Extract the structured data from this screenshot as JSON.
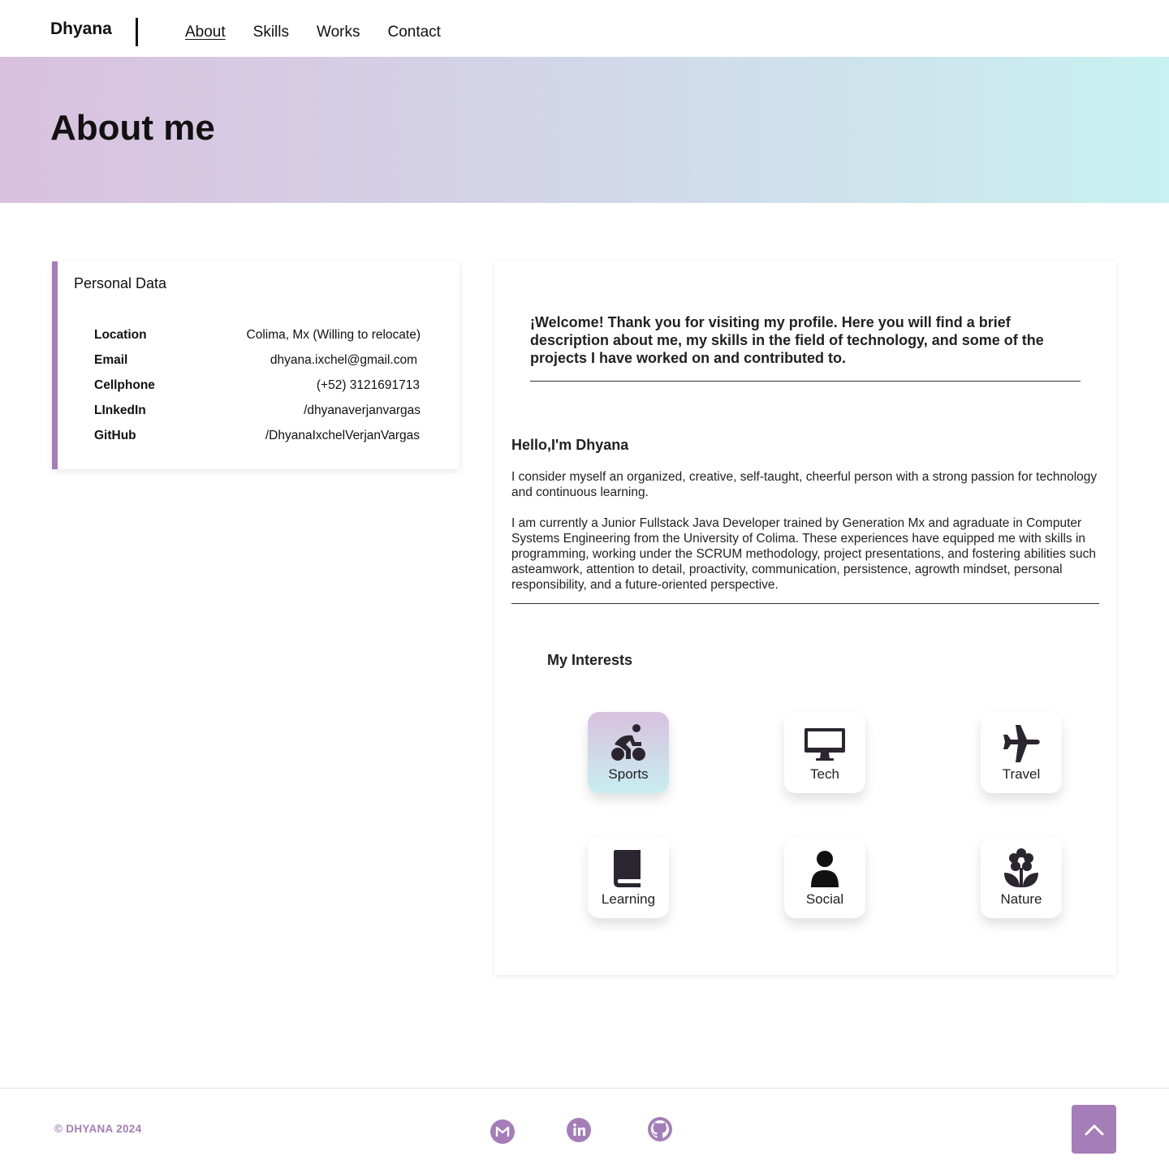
{
  "nav": {
    "brand": "Dhyana",
    "links": [
      {
        "label": "About",
        "active": true
      },
      {
        "label": "Skills"
      },
      {
        "label": "Works"
      },
      {
        "label": "Contact"
      }
    ]
  },
  "hero": {
    "title": "About me"
  },
  "personal": {
    "title": "Personal Data",
    "rows": [
      {
        "label": "Location",
        "value": "Colima, Mx (Willing to relocate)"
      },
      {
        "label": "Email",
        "value": "dhyana.ixchel@gmail.com"
      },
      {
        "label": "Cellphone",
        "value": "(+52) 3121691713"
      },
      {
        "label": "LInkedIn",
        "value": "/dhyanaverjanvargas"
      },
      {
        "label": "GitHub",
        "value": "/DhyanaIxchelVerjanVargas"
      }
    ]
  },
  "about": {
    "welcome": "¡Welcome! Thank you for visiting my profile. Here you will find a brief description about me, my skills in the field of technology, and some of the projects I have worked on and contributed to.",
    "hello": "Hello,I'm Dhyana",
    "paragraph1": "I consider myself an organized, creative, self-taught, cheerful person with a strong passion for technology and continuous learning.",
    "paragraph2": "I am currently a Junior Fullstack Java Developer trained by Generation Mx and agraduate in Computer Systems Engineering from the University of Colima. These experiences have equipped me with skills in programming, working under the SCRUM methodology, project presentations, and fostering abilities such asteamwork, attention to detail, proactivity, communication, persistence, agrowth mindset, personal responsibility, and a future-oriented perspective."
  },
  "interests": {
    "title": "My Interests",
    "items": [
      {
        "label": "Sports",
        "icon": "bicycle-icon",
        "active": true
      },
      {
        "label": "Tech",
        "icon": "desktop-icon"
      },
      {
        "label": "Travel",
        "icon": "plane-icon"
      },
      {
        "label": "Learning",
        "icon": "book-icon"
      },
      {
        "label": "Social",
        "icon": "user-icon"
      },
      {
        "label": "Nature",
        "icon": "flower-icon"
      }
    ]
  },
  "footer": {
    "copyright": "© DHYANA 2024",
    "social": [
      {
        "name": "gmail-icon"
      },
      {
        "name": "linkedin-icon"
      },
      {
        "name": "github-icon"
      }
    ],
    "to_top_icon": "chevron-up-icon"
  },
  "colors": {
    "accent": "#a57db8",
    "hero_start": "#d9c1df",
    "hero_end": "#c8f1f1"
  }
}
